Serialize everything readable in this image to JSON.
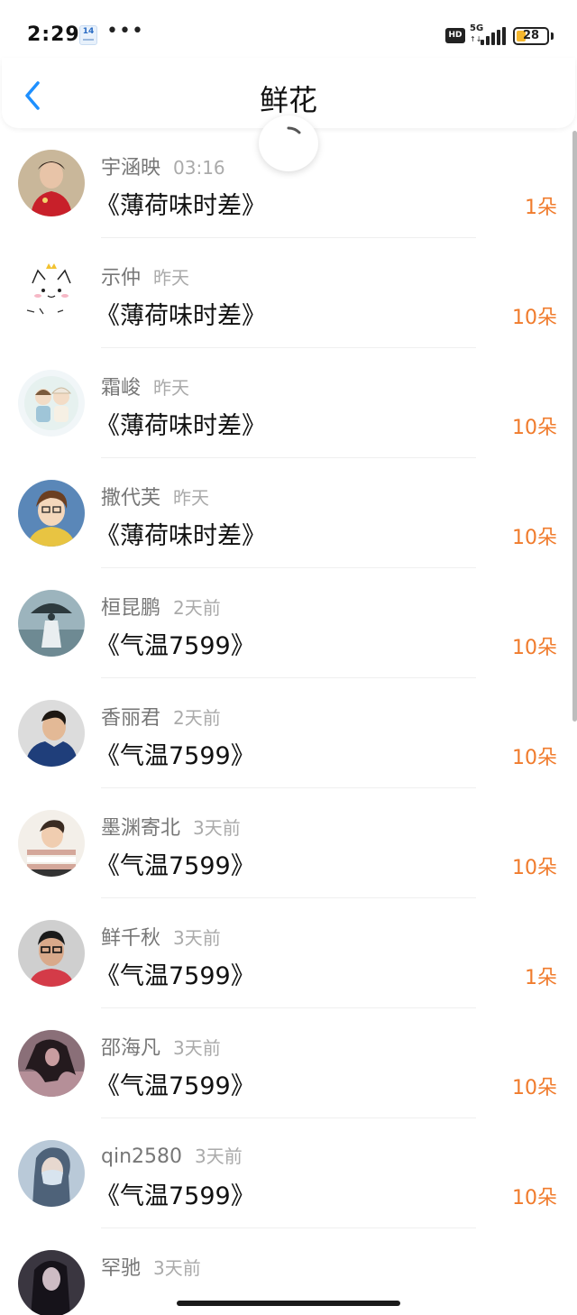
{
  "status_bar": {
    "time": "2:29",
    "calendar_day": "14",
    "more": "•••",
    "hd": "HD",
    "network": "5G",
    "network_arrows": "↑↓",
    "battery": "28"
  },
  "header": {
    "title": "鲜花"
  },
  "colors": {
    "accent": "#1e90ff",
    "count": "#f07b2c",
    "name": "#777777",
    "time": "#aaaaaa"
  },
  "list": [
    {
      "name": "宇涵映",
      "time": "03:16",
      "title": "《薄荷味时差》",
      "count": "1朵",
      "avatar_icon": "avatar-woman-red-dress"
    },
    {
      "name": "示仲",
      "time": "昨天",
      "title": "《薄荷味时差》",
      "count": "10朵",
      "avatar_icon": "avatar-cartoon-cat"
    },
    {
      "name": "霜峻",
      "time": "昨天",
      "title": "《薄荷味时差》",
      "count": "10朵",
      "avatar_icon": "avatar-cartoon-couple"
    },
    {
      "name": "撒代芙",
      "time": "昨天",
      "title": "《薄荷味时差》",
      "count": "10朵",
      "avatar_icon": "avatar-anime-boy"
    },
    {
      "name": "桓昆鹏",
      "time": "2天前",
      "title": "《气温7599》",
      "count": "10朵",
      "avatar_icon": "avatar-painting-umbrella"
    },
    {
      "name": "香丽君",
      "time": "2天前",
      "title": "《气温7599》",
      "count": "10朵",
      "avatar_icon": "avatar-man-blue-jacket"
    },
    {
      "name": "墨渊寄北",
      "time": "3天前",
      "title": "《气温7599》",
      "count": "10朵",
      "avatar_icon": "avatar-boy-striped"
    },
    {
      "name": "鲜千秋",
      "time": "3天前",
      "title": "《气温7599》",
      "count": "1朵",
      "avatar_icon": "avatar-woman-glasses"
    },
    {
      "name": "邵海凡",
      "time": "3天前",
      "title": "《气温7599》",
      "count": "10朵",
      "avatar_icon": "avatar-woman-hair-wind"
    },
    {
      "name": "qin2580",
      "time": "3天前",
      "title": "《气温7599》",
      "count": "10朵",
      "avatar_icon": "avatar-woman-mask"
    },
    {
      "name": "罕驰",
      "time": "3天前",
      "title": "",
      "count": "",
      "avatar_icon": "avatar-woman-dark"
    }
  ]
}
